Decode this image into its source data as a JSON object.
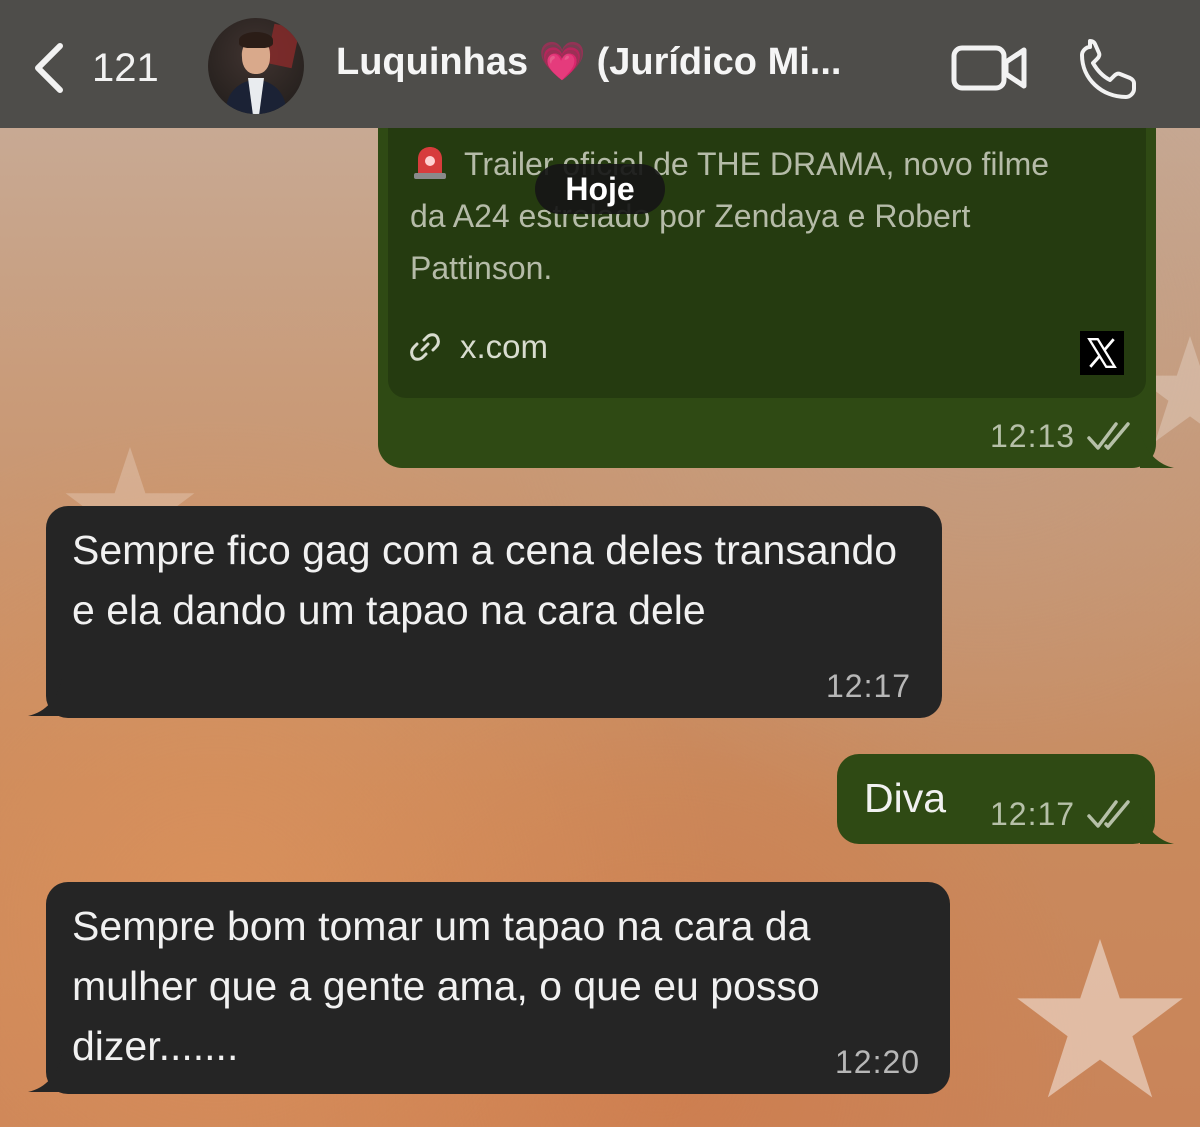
{
  "header": {
    "unread_count": "121",
    "contact_name": "Luquinhas",
    "contact_emoji": "💗",
    "contact_suffix": "(Jurídico Mi...",
    "icons": [
      "back-chevron-icon",
      "video-camera-icon",
      "phone-icon"
    ]
  },
  "date_separator": "Hoje",
  "messages": [
    {
      "direction": "outgoing",
      "preview_text": "Trailer oficial de THE DRAMA, novo filme da A24 estrelado por Zendaya e Robert Pattinson.",
      "preview_icon": "police-siren-emoji",
      "link_domain": "x.com",
      "link_logo": "x-logo-icon",
      "time": "12:13",
      "status": "read-double-check"
    },
    {
      "direction": "incoming",
      "text": "Sempre fico gag com a cena deles transando e ela dando um tapao na cara dele",
      "time": "12:17"
    },
    {
      "direction": "outgoing",
      "text": "Diva",
      "time": "12:17",
      "status": "read-double-check"
    },
    {
      "direction": "incoming",
      "text": "Sempre bom tomar um tapao na cara da mulher que a gente ama, o que eu posso dizer.......",
      "time": "12:20"
    }
  ],
  "colors": {
    "header_bg": "#4e4d4a",
    "outgoing_bubble": "#2f4a14",
    "incoming_bubble": "#252525",
    "wallpaper": "#c98a5d"
  }
}
